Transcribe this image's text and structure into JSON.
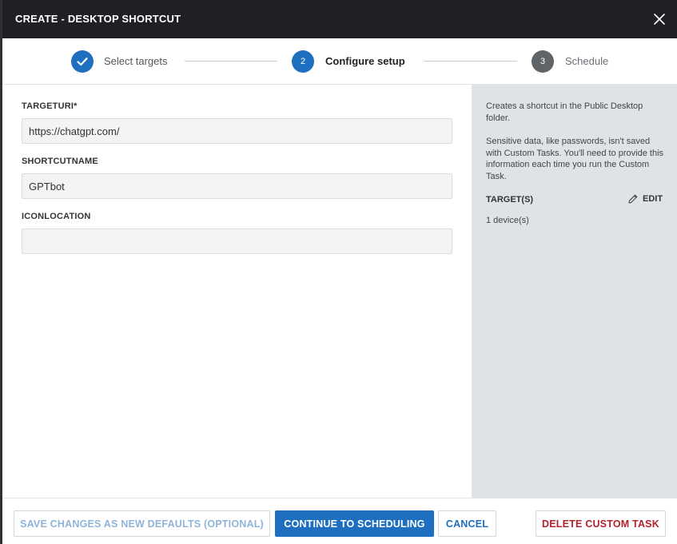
{
  "dialog": {
    "title": "CREATE - DESKTOP SHORTCUT"
  },
  "stepper": {
    "steps": [
      {
        "number": "1",
        "label": "Select targets",
        "state": "done"
      },
      {
        "number": "2",
        "label": "Configure setup",
        "state": "active"
      },
      {
        "number": "3",
        "label": "Schedule",
        "state": "pending"
      }
    ]
  },
  "form": {
    "fields": [
      {
        "label": "TARGETURI*",
        "value": "https://chatgpt.com/",
        "placeholder": ""
      },
      {
        "label": "SHORTCUTNAME",
        "value": "GPTbot",
        "placeholder": ""
      },
      {
        "label": "ICONLOCATION",
        "value": "",
        "placeholder": ""
      }
    ]
  },
  "side": {
    "description": "Creates a shortcut in the Public Desktop folder.",
    "note": "Sensitive data, like passwords, isn't saved with Custom Tasks. You'll need to provide this information each time you run the Custom Task.",
    "targets_heading": "TARGET(S)",
    "edit_label": "EDIT",
    "targets_value": "1 device(s)"
  },
  "footer": {
    "save_defaults": "SAVE CHANGES AS NEW DEFAULTS (OPTIONAL)",
    "continue": "CONTINUE TO SCHEDULING",
    "cancel": "CANCEL",
    "delete": "DELETE CUSTOM TASK"
  },
  "colors": {
    "header_bg": "#1f2024",
    "accent": "#1f6fc0",
    "pending_step": "#5f6469",
    "side_bg": "#dfe3e8",
    "danger": "#b0232e"
  }
}
